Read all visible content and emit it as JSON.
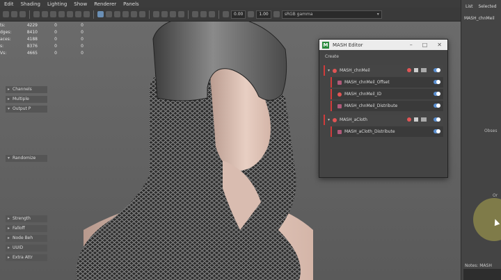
{
  "menubar": {
    "items": [
      "Edit",
      "Shading",
      "Lighting",
      "Show",
      "Renderer",
      "Panels"
    ]
  },
  "toolbar": {
    "value1": "0.00",
    "value2": "1.00",
    "colorspace": "sRGB gamma"
  },
  "hud": {
    "rows": [
      {
        "label": "ts:",
        "c1": "4229",
        "c2": "0",
        "c3": "0"
      },
      {
        "label": "dges:",
        "c1": "8410",
        "c2": "0",
        "c3": "0"
      },
      {
        "label": "aces:",
        "c1": "4188",
        "c2": "0",
        "c3": "0"
      },
      {
        "label": "s:",
        "c1": "8376",
        "c2": "0",
        "c3": "0"
      },
      {
        "label": "Vs:",
        "c1": "4665",
        "c2": "0",
        "c3": "0"
      }
    ]
  },
  "mash_editor": {
    "title": "MASH Editor",
    "create_label": "Create",
    "network1": {
      "name": "MASH_chnMeil",
      "children": [
        "MASH_chnMeil_Offset",
        "MASH_chnMeil_ID",
        "MASH_chnMeil_Distribute"
      ]
    },
    "network2": {
      "name": "MASH_aCloth",
      "children": [
        "MASH_aCloth_Distribute"
      ]
    }
  },
  "right_panel": {
    "tabs": [
      "List",
      "Selected"
    ],
    "title": "MASH_chnMeil",
    "sections": [
      {
        "label": "Channels",
        "open": false
      },
      {
        "label": "Multiple",
        "open": false
      },
      {
        "label": "Output P",
        "open": true
      },
      {
        "label": "Randomize",
        "open": true
      },
      {
        "label": "Strength",
        "open": false
      },
      {
        "label": "Falloff",
        "open": false
      },
      {
        "label": "Node Beh",
        "open": false
      },
      {
        "label": "UUID",
        "open": false
      },
      {
        "label": "Extra Attr",
        "open": false
      }
    ],
    "texts": [
      "Obses",
      "Or"
    ],
    "notes": "Notes: MASH"
  },
  "colors": {
    "accent_red": "#d23b3b",
    "toggle_blue": "#5b8fd0",
    "logo_green": "#2b8a3e"
  }
}
